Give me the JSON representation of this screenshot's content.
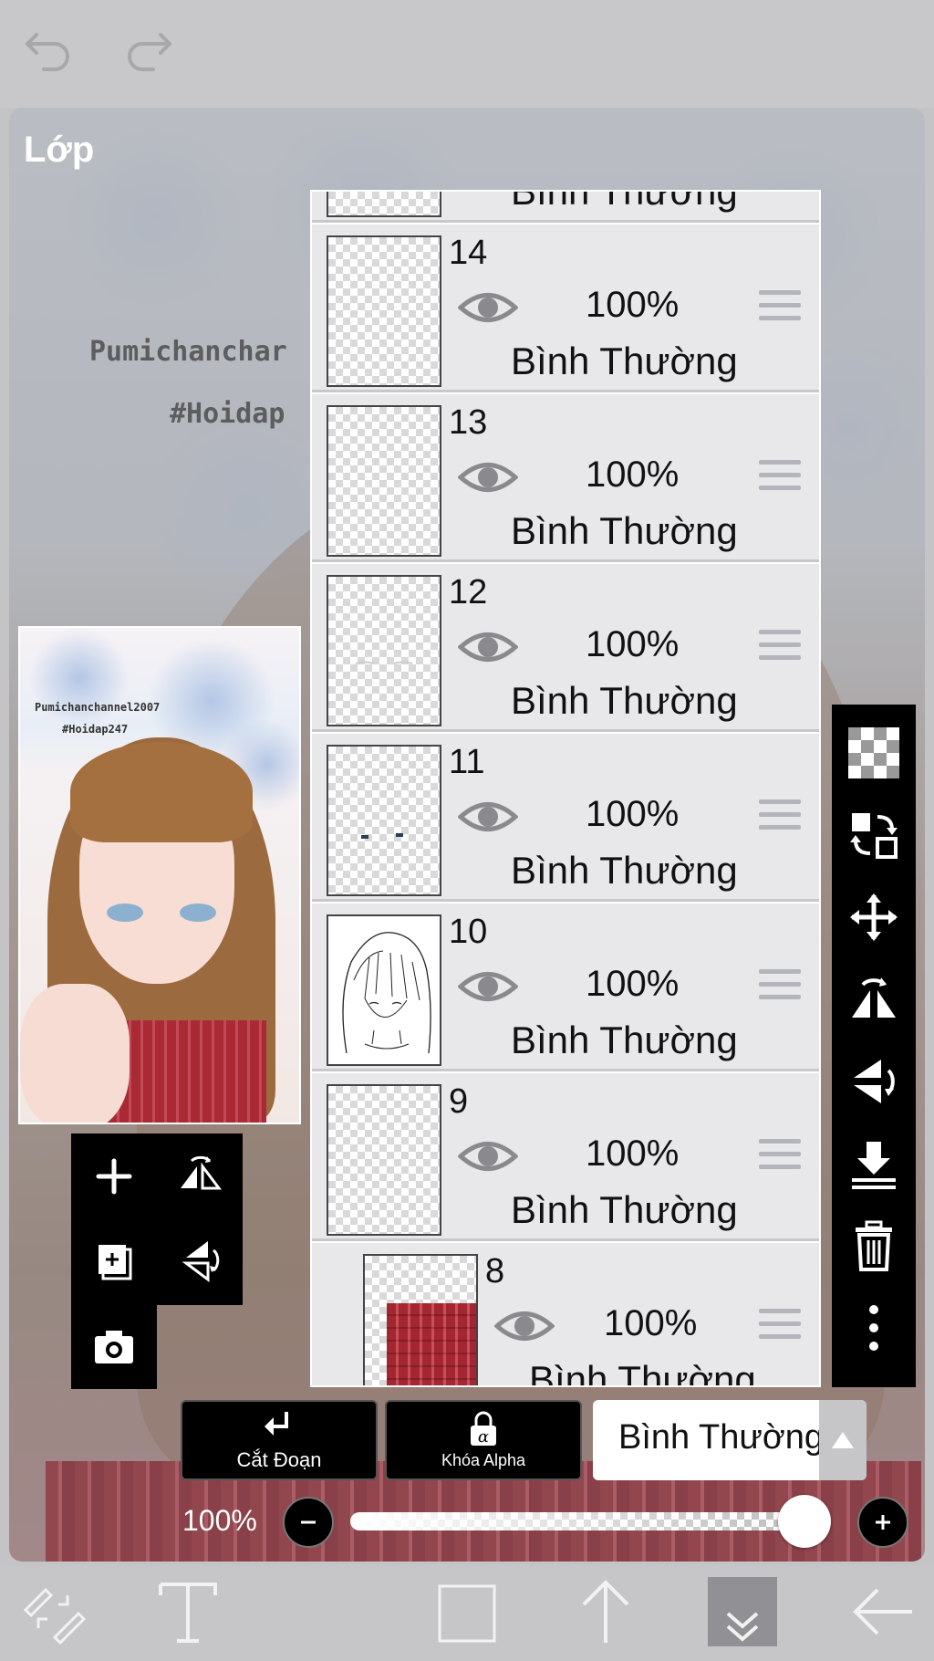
{
  "panel": {
    "title": "Lớp"
  },
  "artwork": {
    "watermark_1": "Pumichanchar",
    "watermark_2": "#Hoidap",
    "preview_text_1": "Pumichanchannel2007",
    "preview_text_2": "#Hoidap247"
  },
  "layers": [
    {
      "number": "14",
      "opacity": "100%",
      "blend": "Bình Thường",
      "thumb": "empty"
    },
    {
      "number": "13",
      "opacity": "100%",
      "blend": "Bình Thường",
      "thumb": "empty"
    },
    {
      "number": "12",
      "opacity": "100%",
      "blend": "Bình Thường",
      "thumb": "faint-lines"
    },
    {
      "number": "11",
      "opacity": "100%",
      "blend": "Bình Thường",
      "thumb": "eye-marks"
    },
    {
      "number": "10",
      "opacity": "100%",
      "blend": "Bình Thường",
      "thumb": "lineart"
    },
    {
      "number": "9",
      "opacity": "100%",
      "blend": "Bình Thường",
      "thumb": "empty"
    },
    {
      "number": "8",
      "opacity": "100%",
      "blend": "Bình Thường",
      "thumb": "plaid"
    }
  ],
  "partial_layer_top": {
    "blend": "Bình Thường"
  },
  "bottom_controls": {
    "clip_label": "Cắt Đoạn",
    "alpha_lock_label": "Khóa Alpha",
    "blend_mode": "Bình Thường",
    "opacity_label": "100%",
    "opacity_value": 1.0
  },
  "icons": {
    "top": [
      "undo-icon",
      "redo-icon"
    ],
    "left_tools": [
      "add-layer-icon",
      "flip-horizontal-icon",
      "duplicate-layer-icon",
      "flip-vertical-icon",
      "camera-icon"
    ],
    "right_tools": [
      "transparency-icon",
      "swap-layer-icon",
      "move-icon",
      "flip-horizontal-icon",
      "flip-vertical-icon",
      "merge-down-icon",
      "trash-icon",
      "more-icon"
    ],
    "bottom": [
      "brush-eraser-icon",
      "text-icon",
      "select-icon",
      "arrow-up-icon",
      "chevron-down-icon",
      "back-arrow-icon"
    ]
  },
  "colors": {
    "panel_black": "#000000",
    "layer_bg": "#e8e8ea",
    "accent_red": "#a92935"
  }
}
